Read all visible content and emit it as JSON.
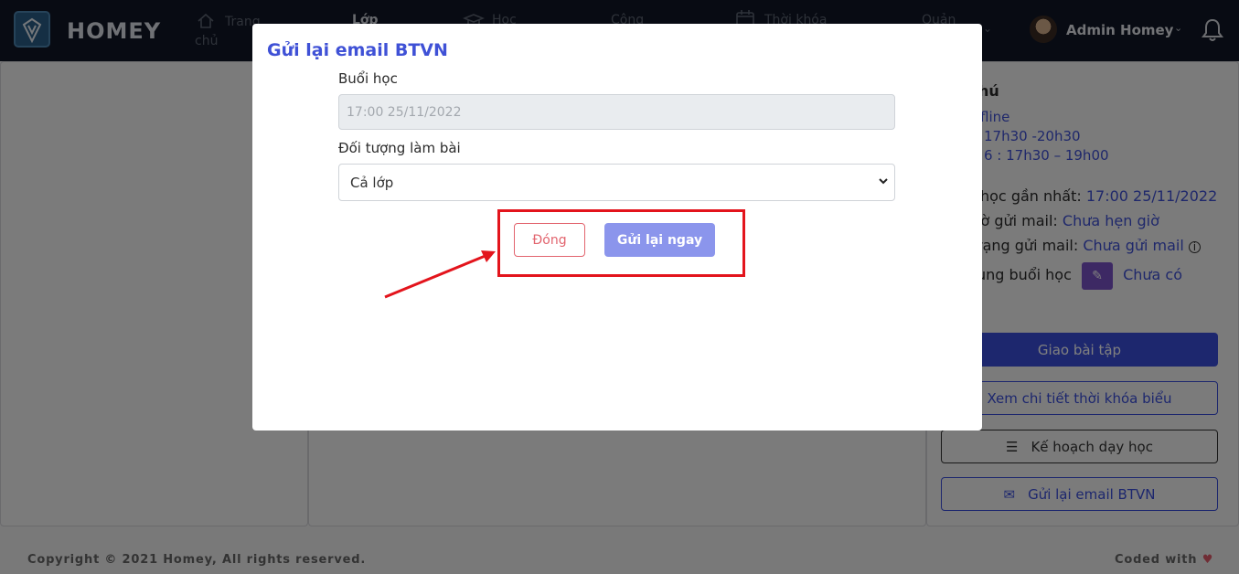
{
  "brand": {
    "name": "HOMEY"
  },
  "nav": {
    "items": [
      {
        "label": "Trang chủ",
        "icon": "home-icon"
      },
      {
        "label": "Lớp",
        "icon": "class-icon"
      },
      {
        "label": "Học",
        "icon": "graduation-cap-icon"
      },
      {
        "label": "Công",
        "icon": "user-icon"
      },
      {
        "label": "Thời khóa",
        "icon": "calendar-icon"
      },
      {
        "label": "Quản",
        "icon": "manage-icon"
      }
    ],
    "user_name": "Admin Homey"
  },
  "sidebar_info": {
    "heading_fragment": "hú",
    "line_online": "fline",
    "time1": "17h30 -20h30",
    "time2": "6 : 17h30 – 19h00",
    "recent_label": "học gần nhất:",
    "recent_value": "17:00 25/11/2022",
    "send_time_label": "iờ gửi mail:",
    "send_time_value": "Chưa hẹn giờ",
    "status_label": "rạng gửi mail:",
    "status_value": "Chưa gửi mail",
    "content_label": "ung buổi học",
    "content_value": "Chưa có"
  },
  "sidebar_buttons": {
    "assign": "Giao bài tập",
    "timetable": "Xem chi tiết thời khóa biểu",
    "plan": "Kế hoạch dạy học",
    "resend": "Gửi lại email BTVN"
  },
  "footer": {
    "copyright": "Copyright © 2021 Homey, All rights reserved.",
    "coded_with": "Coded with"
  },
  "modal": {
    "title": "Gửi lại email BTVN",
    "session_label": "Buổi học",
    "session_value": "17:00 25/11/2022",
    "target_label": "Đối tượng làm bài",
    "target_value": "Cả lớp",
    "close_button": "Đóng",
    "send_button": "Gửi lại ngay"
  },
  "colors": {
    "accent": "#3f51d6",
    "send_button": "#8b95ec",
    "close_button": "#e2646e",
    "annotation": "#e3141c"
  }
}
